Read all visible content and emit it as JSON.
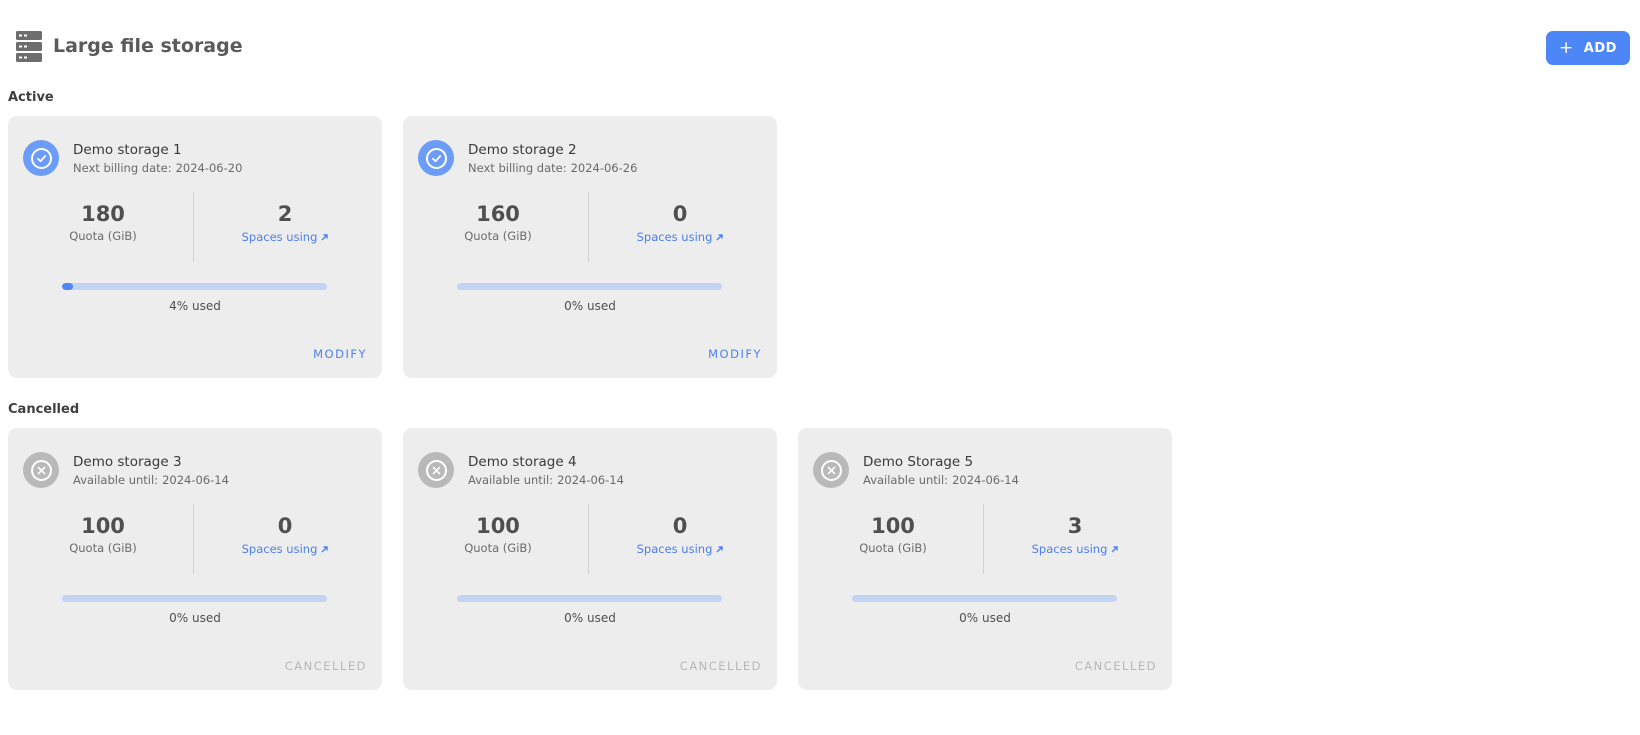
{
  "header": {
    "title": "Large file storage",
    "icon": "server-storage-icon",
    "add_button": {
      "icon": "plus-icon",
      "label": "ADD"
    }
  },
  "colors": {
    "accent": "#4d86f7",
    "link": "#4d7ff0",
    "card_background": "#ededed",
    "progress_track": "#c3d3f3",
    "cancelled_gray": "#b9b9b9"
  },
  "sections": {
    "active": {
      "label": "Active",
      "cards": [
        {
          "name": "Demo storage 1",
          "date_label": "Next billing date:",
          "date": "2024-06-20",
          "status_icon": "check-circle-icon",
          "quota_value": "180",
          "quota_label": "Quota (GiB)",
          "spaces_value": "2",
          "spaces_label": "Spaces using",
          "used_percent": 4,
          "usage_text": "4% used",
          "action": "MODIFY"
        },
        {
          "name": "Demo storage 2",
          "date_label": "Next billing date:",
          "date": "2024-06-26",
          "status_icon": "check-circle-icon",
          "quota_value": "160",
          "quota_label": "Quota (GiB)",
          "spaces_value": "0",
          "spaces_label": "Spaces using",
          "used_percent": 0,
          "usage_text": "0% used",
          "action": "MODIFY"
        }
      ]
    },
    "cancelled": {
      "label": "Cancelled",
      "cards": [
        {
          "name": "Demo storage 3",
          "date_label": "Available until:",
          "date": "2024-06-14",
          "status_icon": "x-circle-icon",
          "quota_value": "100",
          "quota_label": "Quota (GiB)",
          "spaces_value": "0",
          "spaces_label": "Spaces using",
          "used_percent": 0,
          "usage_text": "0% used",
          "action": "CANCELLED"
        },
        {
          "name": "Demo storage 4",
          "date_label": "Available until:",
          "date": "2024-06-14",
          "status_icon": "x-circle-icon",
          "quota_value": "100",
          "quota_label": "Quota (GiB)",
          "spaces_value": "0",
          "spaces_label": "Spaces using",
          "used_percent": 0,
          "usage_text": "0% used",
          "action": "CANCELLED"
        },
        {
          "name": "Demo Storage 5",
          "date_label": "Available until:",
          "date": "2024-06-14",
          "status_icon": "x-circle-icon",
          "quota_value": "100",
          "quota_label": "Quota (GiB)",
          "spaces_value": "3",
          "spaces_label": "Spaces using",
          "used_percent": 0,
          "usage_text": "0% used",
          "action": "CANCELLED"
        }
      ]
    }
  }
}
